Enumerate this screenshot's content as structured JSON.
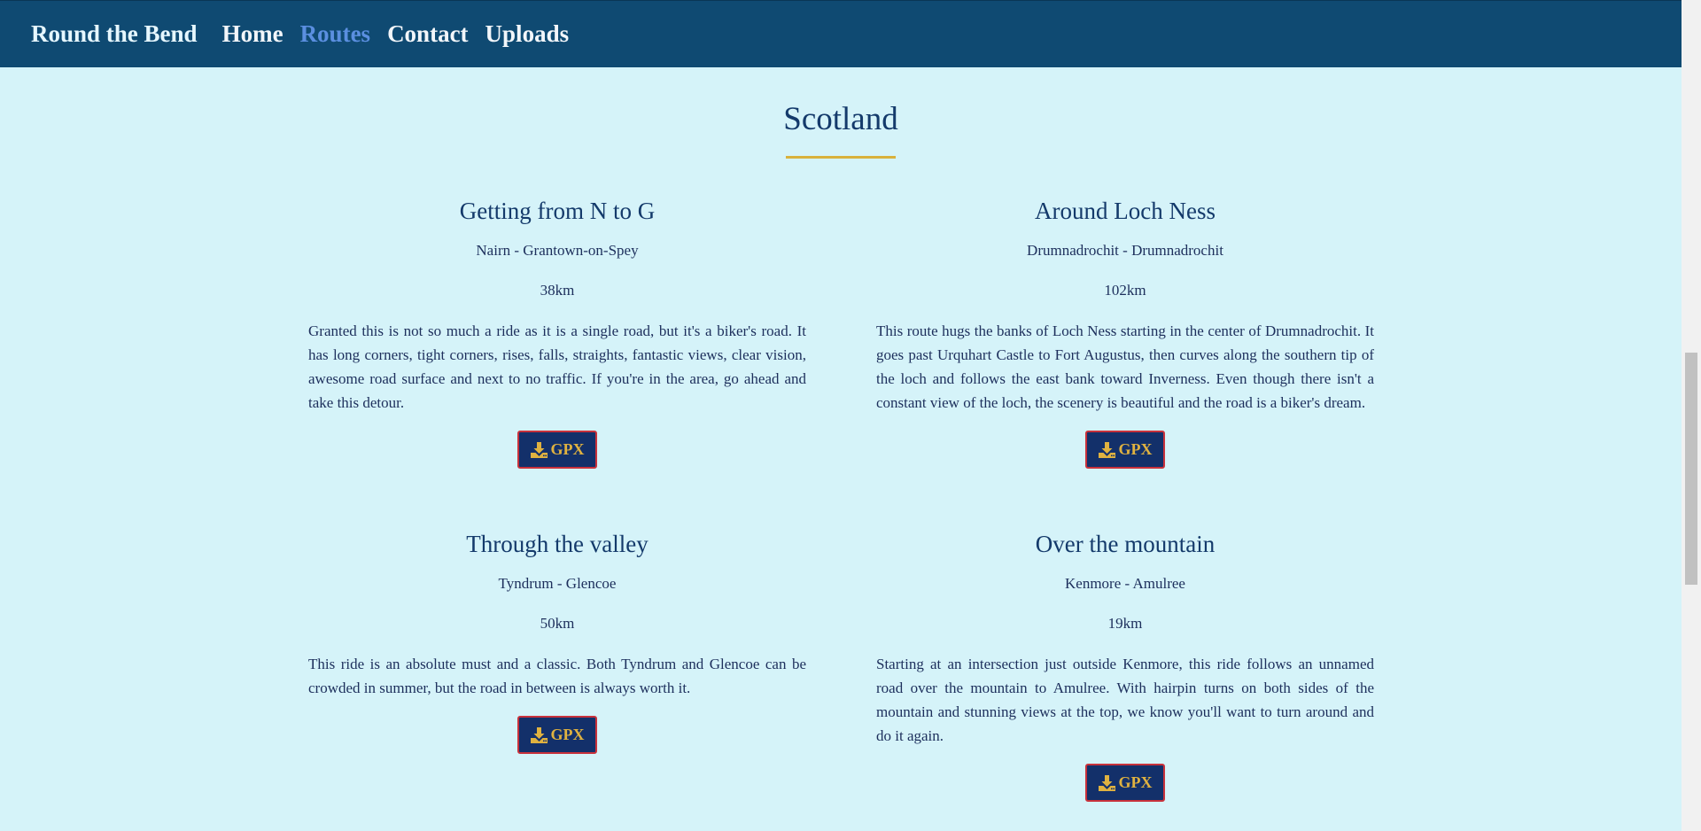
{
  "nav": {
    "brand": "Round the Bend",
    "links": [
      "Home",
      "Routes",
      "Contact",
      "Uploads"
    ],
    "active": "Routes"
  },
  "section": {
    "title": "Scotland"
  },
  "routes": [
    {
      "name": "Getting from N to G",
      "endpoints": "Nairn - Grantown-on-Spey",
      "distance": "38km",
      "description": "Granted this is not so much a ride as it is a single road, but it's a biker's road. It has long corners, tight corners, rises, falls, straights, fantastic views, clear vision, awesome road surface and next to no traffic. If you're in the area, go ahead and take this detour.",
      "button_label": "GPX"
    },
    {
      "name": "Around Loch Ness",
      "endpoints": "Drumnadrochit - Drumnadrochit",
      "distance": "102km",
      "description": "This route hugs the banks of Loch Ness starting in the center of Drumnadrochit. It goes past Urquhart Castle to Fort Augustus, then curves along the southern tip of the loch and follows the east bank toward Inverness. Even though there isn't a constant view of the loch, the scenery is beautiful and the road is a biker's dream.",
      "button_label": "GPX"
    },
    {
      "name": "Through the valley",
      "endpoints": "Tyndrum - Glencoe",
      "distance": "50km",
      "description": "This ride is an absolute must and a classic. Both Tyndrum and Glencoe can be crowded in summer, but the road in between is always worth it.",
      "button_label": "GPX"
    },
    {
      "name": "Over the mountain",
      "endpoints": "Kenmore - Amulree",
      "distance": "19km",
      "description": "Starting at an intersection just outside Kenmore, this ride follows an unnamed road over the mountain to Amulree. With hairpin turns on both sides of the mountain and stunning views at the top, we know you'll want to turn around and do it again.",
      "button_label": "GPX"
    }
  ],
  "colors": {
    "navbar": "#0f4a72",
    "background": "#d5f3f9",
    "active_link": "#5b8fe0",
    "accent_gold": "#d9b13c",
    "button_bg": "#13306a",
    "button_border": "#c8313b"
  },
  "icons": {
    "gpx_button": "download-icon"
  }
}
